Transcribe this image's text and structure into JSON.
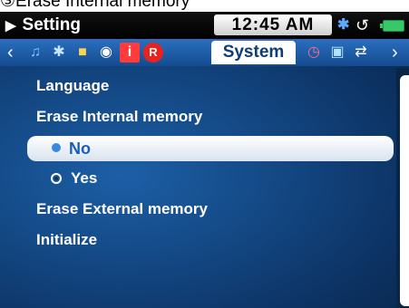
{
  "caption": "③Erase Internal memory",
  "status": {
    "title": "Setting",
    "time": "12:45 AM",
    "bluetooth_icon": "✱",
    "repeat_icon": "↺"
  },
  "tabs": {
    "left_arrow": "‹",
    "right_arrow": "›",
    "active_label": "System",
    "icons": [
      {
        "name": "music-icon",
        "glyph": "♫",
        "color": "#7ec8ff"
      },
      {
        "name": "bluetooth-tab-icon",
        "glyph": "✱",
        "color": "#c9e6ff"
      },
      {
        "name": "photo-icon",
        "glyph": "■",
        "color": "#ffd34d"
      },
      {
        "name": "disc-icon",
        "glyph": "◉",
        "color": "#ffffff"
      },
      {
        "name": "info-icon",
        "glyph": "i",
        "color": "#ff3b3b"
      },
      {
        "name": "record-icon",
        "glyph": "R",
        "color": "#e8231f"
      },
      {
        "name": "clock-icon",
        "glyph": "◷",
        "color": "#ff6b8a"
      },
      {
        "name": "display-icon",
        "glyph": "▣",
        "color": "#aee2ff"
      },
      {
        "name": "sync-icon",
        "glyph": "⇄",
        "color": "#ffffff"
      }
    ]
  },
  "menu": {
    "language": "Language",
    "erase_internal": "Erase Internal memory",
    "option_no": "No",
    "option_yes": "Yes",
    "erase_external": "Erase External memory",
    "initialize": "Initialize"
  }
}
